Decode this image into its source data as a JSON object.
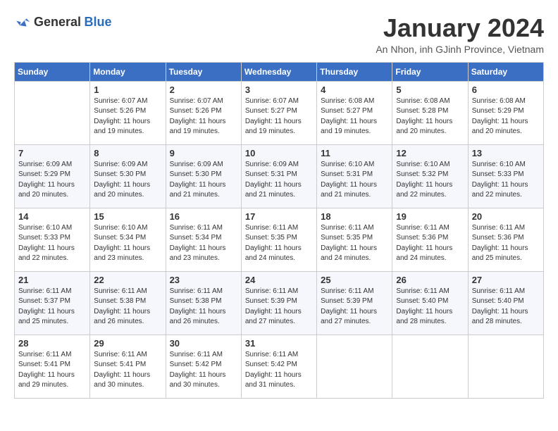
{
  "logo": {
    "general": "General",
    "blue": "Blue"
  },
  "title": "January 2024",
  "subtitle": "An Nhon, inh GJinh Province, Vietnam",
  "days_of_week": [
    "Sunday",
    "Monday",
    "Tuesday",
    "Wednesday",
    "Thursday",
    "Friday",
    "Saturday"
  ],
  "weeks": [
    [
      {
        "day": "",
        "sunrise": "",
        "sunset": "",
        "daylight": ""
      },
      {
        "day": "1",
        "sunrise": "Sunrise: 6:07 AM",
        "sunset": "Sunset: 5:26 PM",
        "daylight": "Daylight: 11 hours and 19 minutes."
      },
      {
        "day": "2",
        "sunrise": "Sunrise: 6:07 AM",
        "sunset": "Sunset: 5:26 PM",
        "daylight": "Daylight: 11 hours and 19 minutes."
      },
      {
        "day": "3",
        "sunrise": "Sunrise: 6:07 AM",
        "sunset": "Sunset: 5:27 PM",
        "daylight": "Daylight: 11 hours and 19 minutes."
      },
      {
        "day": "4",
        "sunrise": "Sunrise: 6:08 AM",
        "sunset": "Sunset: 5:27 PM",
        "daylight": "Daylight: 11 hours and 19 minutes."
      },
      {
        "day": "5",
        "sunrise": "Sunrise: 6:08 AM",
        "sunset": "Sunset: 5:28 PM",
        "daylight": "Daylight: 11 hours and 20 minutes."
      },
      {
        "day": "6",
        "sunrise": "Sunrise: 6:08 AM",
        "sunset": "Sunset: 5:29 PM",
        "daylight": "Daylight: 11 hours and 20 minutes."
      }
    ],
    [
      {
        "day": "7",
        "sunrise": "Sunrise: 6:09 AM",
        "sunset": "Sunset: 5:29 PM",
        "daylight": "Daylight: 11 hours and 20 minutes."
      },
      {
        "day": "8",
        "sunrise": "Sunrise: 6:09 AM",
        "sunset": "Sunset: 5:30 PM",
        "daylight": "Daylight: 11 hours and 20 minutes."
      },
      {
        "day": "9",
        "sunrise": "Sunrise: 6:09 AM",
        "sunset": "Sunset: 5:30 PM",
        "daylight": "Daylight: 11 hours and 21 minutes."
      },
      {
        "day": "10",
        "sunrise": "Sunrise: 6:09 AM",
        "sunset": "Sunset: 5:31 PM",
        "daylight": "Daylight: 11 hours and 21 minutes."
      },
      {
        "day": "11",
        "sunrise": "Sunrise: 6:10 AM",
        "sunset": "Sunset: 5:31 PM",
        "daylight": "Daylight: 11 hours and 21 minutes."
      },
      {
        "day": "12",
        "sunrise": "Sunrise: 6:10 AM",
        "sunset": "Sunset: 5:32 PM",
        "daylight": "Daylight: 11 hours and 22 minutes."
      },
      {
        "day": "13",
        "sunrise": "Sunrise: 6:10 AM",
        "sunset": "Sunset: 5:33 PM",
        "daylight": "Daylight: 11 hours and 22 minutes."
      }
    ],
    [
      {
        "day": "14",
        "sunrise": "Sunrise: 6:10 AM",
        "sunset": "Sunset: 5:33 PM",
        "daylight": "Daylight: 11 hours and 22 minutes."
      },
      {
        "day": "15",
        "sunrise": "Sunrise: 6:10 AM",
        "sunset": "Sunset: 5:34 PM",
        "daylight": "Daylight: 11 hours and 23 minutes."
      },
      {
        "day": "16",
        "sunrise": "Sunrise: 6:11 AM",
        "sunset": "Sunset: 5:34 PM",
        "daylight": "Daylight: 11 hours and 23 minutes."
      },
      {
        "day": "17",
        "sunrise": "Sunrise: 6:11 AM",
        "sunset": "Sunset: 5:35 PM",
        "daylight": "Daylight: 11 hours and 24 minutes."
      },
      {
        "day": "18",
        "sunrise": "Sunrise: 6:11 AM",
        "sunset": "Sunset: 5:35 PM",
        "daylight": "Daylight: 11 hours and 24 minutes."
      },
      {
        "day": "19",
        "sunrise": "Sunrise: 6:11 AM",
        "sunset": "Sunset: 5:36 PM",
        "daylight": "Daylight: 11 hours and 24 minutes."
      },
      {
        "day": "20",
        "sunrise": "Sunrise: 6:11 AM",
        "sunset": "Sunset: 5:36 PM",
        "daylight": "Daylight: 11 hours and 25 minutes."
      }
    ],
    [
      {
        "day": "21",
        "sunrise": "Sunrise: 6:11 AM",
        "sunset": "Sunset: 5:37 PM",
        "daylight": "Daylight: 11 hours and 25 minutes."
      },
      {
        "day": "22",
        "sunrise": "Sunrise: 6:11 AM",
        "sunset": "Sunset: 5:38 PM",
        "daylight": "Daylight: 11 hours and 26 minutes."
      },
      {
        "day": "23",
        "sunrise": "Sunrise: 6:11 AM",
        "sunset": "Sunset: 5:38 PM",
        "daylight": "Daylight: 11 hours and 26 minutes."
      },
      {
        "day": "24",
        "sunrise": "Sunrise: 6:11 AM",
        "sunset": "Sunset: 5:39 PM",
        "daylight": "Daylight: 11 hours and 27 minutes."
      },
      {
        "day": "25",
        "sunrise": "Sunrise: 6:11 AM",
        "sunset": "Sunset: 5:39 PM",
        "daylight": "Daylight: 11 hours and 27 minutes."
      },
      {
        "day": "26",
        "sunrise": "Sunrise: 6:11 AM",
        "sunset": "Sunset: 5:40 PM",
        "daylight": "Daylight: 11 hours and 28 minutes."
      },
      {
        "day": "27",
        "sunrise": "Sunrise: 6:11 AM",
        "sunset": "Sunset: 5:40 PM",
        "daylight": "Daylight: 11 hours and 28 minutes."
      }
    ],
    [
      {
        "day": "28",
        "sunrise": "Sunrise: 6:11 AM",
        "sunset": "Sunset: 5:41 PM",
        "daylight": "Daylight: 11 hours and 29 minutes."
      },
      {
        "day": "29",
        "sunrise": "Sunrise: 6:11 AM",
        "sunset": "Sunset: 5:41 PM",
        "daylight": "Daylight: 11 hours and 30 minutes."
      },
      {
        "day": "30",
        "sunrise": "Sunrise: 6:11 AM",
        "sunset": "Sunset: 5:42 PM",
        "daylight": "Daylight: 11 hours and 30 minutes."
      },
      {
        "day": "31",
        "sunrise": "Sunrise: 6:11 AM",
        "sunset": "Sunset: 5:42 PM",
        "daylight": "Daylight: 11 hours and 31 minutes."
      },
      {
        "day": "",
        "sunrise": "",
        "sunset": "",
        "daylight": ""
      },
      {
        "day": "",
        "sunrise": "",
        "sunset": "",
        "daylight": ""
      },
      {
        "day": "",
        "sunrise": "",
        "sunset": "",
        "daylight": ""
      }
    ]
  ]
}
